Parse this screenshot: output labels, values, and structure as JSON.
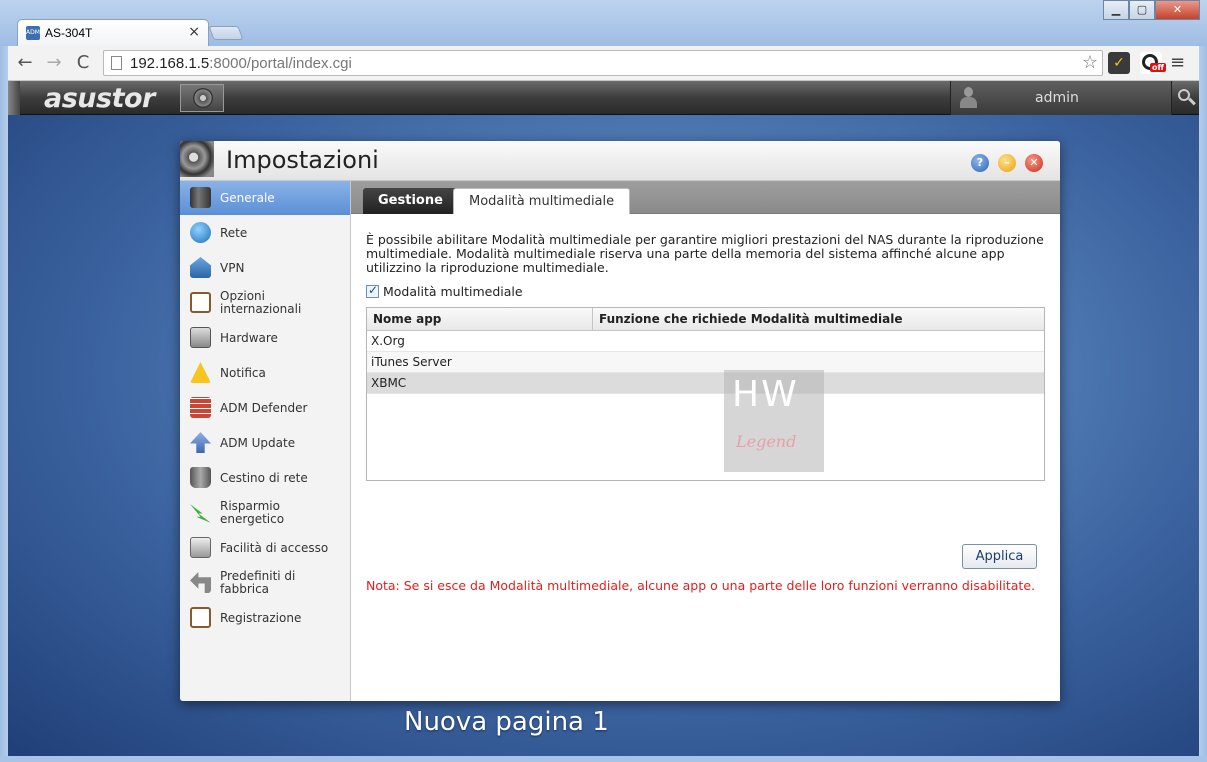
{
  "browser": {
    "tab_title": "AS-304T",
    "tab_close": "×",
    "favicon": "ADM",
    "url_host": "192.168.1.5",
    "url_rest": ":8000/portal/index.cgi",
    "back": "←",
    "forward": "→",
    "reload": "C",
    "star": "☆",
    "menu": "≡",
    "ext_off_badge": "off",
    "win_minimize": "▁",
    "win_maximize": "▢",
    "win_close": "✕"
  },
  "adm": {
    "logo": "asustor",
    "user": "admin"
  },
  "settings": {
    "title": "Impostazioni",
    "help": "?",
    "minimize": "–",
    "close": "✕",
    "sidebar": [
      {
        "label": "Generale",
        "icon": "server-icon"
      },
      {
        "label": "Rete",
        "icon": "globe-icon"
      },
      {
        "label": "VPN",
        "icon": "vpn-house-icon"
      },
      {
        "label": "Opzioni internazionali",
        "icon": "clock-calendar-icon"
      },
      {
        "label": "Hardware",
        "icon": "hard-disk-icon"
      },
      {
        "label": "Notifica",
        "icon": "warning-icon"
      },
      {
        "label": "ADM Defender",
        "icon": "firewall-icon"
      },
      {
        "label": "ADM Update",
        "icon": "up-arrow-icon"
      },
      {
        "label": "Cestino di rete",
        "icon": "trash-icon"
      },
      {
        "label": "Risparmio energetico",
        "icon": "energy-icon"
      },
      {
        "label": "Facilità di accesso",
        "icon": "printer-icon"
      },
      {
        "label": "Predefiniti di fabbrica",
        "icon": "undo-arrow-icon"
      },
      {
        "label": "Registrazione",
        "icon": "clipboard-icon"
      }
    ],
    "tabs": [
      {
        "label": "Gestione"
      },
      {
        "label": "Modalità multimediale"
      }
    ],
    "description": "È possibile abilitare Modalità multimediale per garantire migliori prestazioni del NAS durante la riproduzione multimediale. Modalità multimediale riserva una parte della memoria del sistema affinché alcune app utilizzino la riproduzione multimediale.",
    "checkbox_label": "Modalità multimediale",
    "checkbox_checked": true,
    "table": {
      "columns": [
        "Nome app",
        "Funzione che richiede Modalità multimediale"
      ],
      "rows": [
        {
          "app": "X.Org",
          "function": ""
        },
        {
          "app": "iTunes Server",
          "function": ""
        },
        {
          "app": "XBMC",
          "function": ""
        }
      ]
    },
    "watermark": {
      "top": "HW",
      "bottom": "Legend"
    },
    "apply_label": "Applica",
    "note": "Nota: Se si esce da Modalità multimediale, alcune app o una parte delle loro funzioni verranno disabilitate."
  },
  "desktop_caption": "Nuova pagina 1"
}
